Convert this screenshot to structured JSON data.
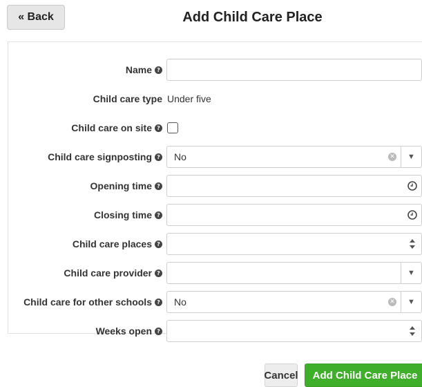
{
  "header": {
    "back_label": "« Back",
    "title": "Add Child Care Place"
  },
  "help_glyph": "?",
  "form": {
    "name": {
      "label": "Name",
      "value": ""
    },
    "child_care_type": {
      "label": "Child care type",
      "value": "Under five"
    },
    "child_care_on_site": {
      "label": "Child care on site",
      "checked": false
    },
    "child_care_signposting": {
      "label": "Child care signposting",
      "selected": "No"
    },
    "opening_time": {
      "label": "Opening time",
      "value": "",
      "icon": "clock-icon"
    },
    "closing_time": {
      "label": "Closing time",
      "value": "",
      "icon": "clock-icon"
    },
    "child_care_places": {
      "label": "Child care places",
      "value": "",
      "icon": "spinner-icon"
    },
    "child_care_provider": {
      "label": "Child care provider",
      "selected": ""
    },
    "child_care_for_other_schools": {
      "label": "Child care for other schools",
      "selected": "No"
    },
    "weeks_open": {
      "label": "Weeks open",
      "value": "",
      "icon": "spinner-icon"
    }
  },
  "footer": {
    "cancel_label": "Cancel",
    "submit_label": "Add Child Care Place"
  },
  "colors": {
    "primary": "#3fae2a",
    "secondary": "#ededed"
  }
}
